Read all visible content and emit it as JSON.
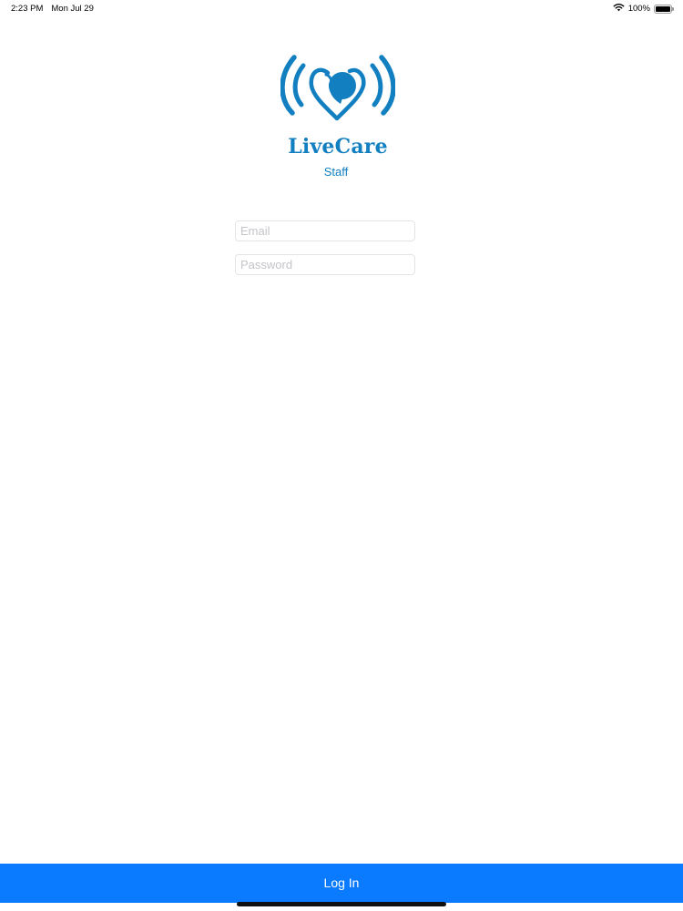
{
  "status_bar": {
    "time": "2:23 PM",
    "date": "Mon Jul 29",
    "battery_text": "100%",
    "battery_level": 1.0,
    "wifi_icon": "wifi-icon",
    "battery_icon": "battery-icon"
  },
  "brand": {
    "logo_icon": "heart-broadcast-logo",
    "name": "LiveCare",
    "subtitle": "Staff",
    "color": "#127FC1"
  },
  "form": {
    "email_placeholder": "Email",
    "email_value": "",
    "password_placeholder": "Password",
    "password_value": ""
  },
  "login_button": {
    "label": "Log In",
    "color": "#0A7AFF"
  }
}
